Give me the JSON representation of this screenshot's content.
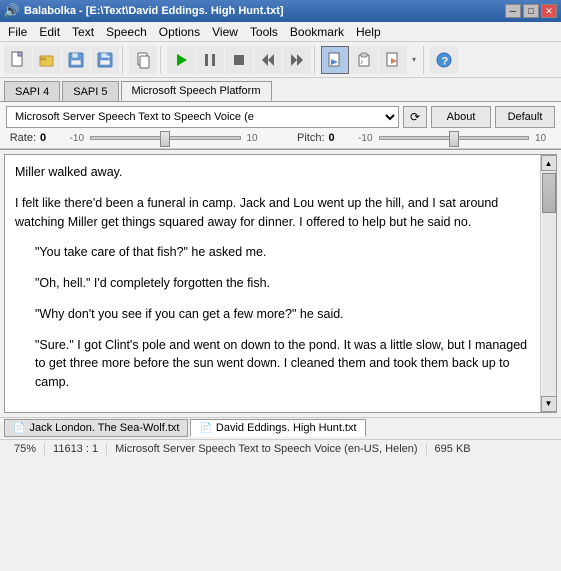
{
  "titleBar": {
    "icon": "🔊",
    "title": "Balabolka - [E:\\Text\\David Eddings. High Hunt.txt]",
    "minimize": "─",
    "maximize": "□",
    "close": "✕"
  },
  "menuBar": {
    "items": [
      "File",
      "Edit",
      "Text",
      "Speech",
      "Options",
      "View",
      "Tools",
      "Bookmark",
      "Help"
    ]
  },
  "toolbar": {
    "buttons": [
      {
        "name": "new",
        "icon": "📄"
      },
      {
        "name": "open",
        "icon": "📂"
      },
      {
        "name": "save",
        "icon": "💾"
      },
      {
        "name": "save-as",
        "icon": "💾"
      },
      {
        "name": "copy-file",
        "icon": "📋"
      },
      {
        "name": "play",
        "icon": "▶"
      },
      {
        "name": "pause",
        "icon": "⏸"
      },
      {
        "name": "stop",
        "icon": "⏹"
      },
      {
        "name": "rewind",
        "icon": "⏮"
      },
      {
        "name": "forward",
        "icon": "⏭"
      },
      {
        "name": "speak-clipboard",
        "icon": "📋"
      },
      {
        "name": "speak-file",
        "icon": "📁"
      },
      {
        "name": "settings",
        "icon": "⚙"
      },
      {
        "name": "info",
        "icon": "ℹ"
      }
    ]
  },
  "speechTabs": {
    "tabs": [
      "SAPI 4",
      "SAPI 5",
      "Microsoft Speech Platform"
    ],
    "activeTab": "Microsoft Speech Platform"
  },
  "voiceSelector": {
    "label": "",
    "value": "Microsoft Server Speech Text to Speech Voice (e",
    "placeholder": "Microsoft Server Speech Text to Speech Voice (e",
    "aboutLabel": "About",
    "defaultLabel": "Default",
    "refreshIcon": "⟳"
  },
  "rateControl": {
    "label": "Rate:",
    "value": "0",
    "min": "-10",
    "max": "10"
  },
  "pitchControl": {
    "label": "Pitch:",
    "value": "0",
    "min": "-10",
    "max": "10"
  },
  "textContent": {
    "paragraphs": [
      "Miller walked away.",
      "I felt like there'd been a funeral in camp.  Jack and Lou went up the hill, and I sat around watching Miller get things squared away for dinner.  I offered to help but he said no.",
      "\"You take care of that fish?\" he asked me.",
      "\"Oh, hell.\" I'd completely forgotten the fish.",
      "\"Why don't you see if you can get a few more?\" he said.",
      "\"Sure.\" I got Clint's pole and went on down to the pond.  It was a little slow, but I managed to get three more before the sun went down.  I cleaned them and took them back up to camp."
    ]
  },
  "docTabs": {
    "tabs": [
      {
        "icon": "📄",
        "label": "Jack London. The Sea-Wolf.txt",
        "active": false
      },
      {
        "icon": "📄",
        "label": "David Eddings. High Hunt.txt",
        "active": true
      }
    ]
  },
  "statusBar": {
    "zoom": "75%",
    "position": "11613 : 1",
    "voice": "Microsoft Server Speech Text to Speech Voice (en-US, Helen)",
    "size": "695 KB"
  }
}
